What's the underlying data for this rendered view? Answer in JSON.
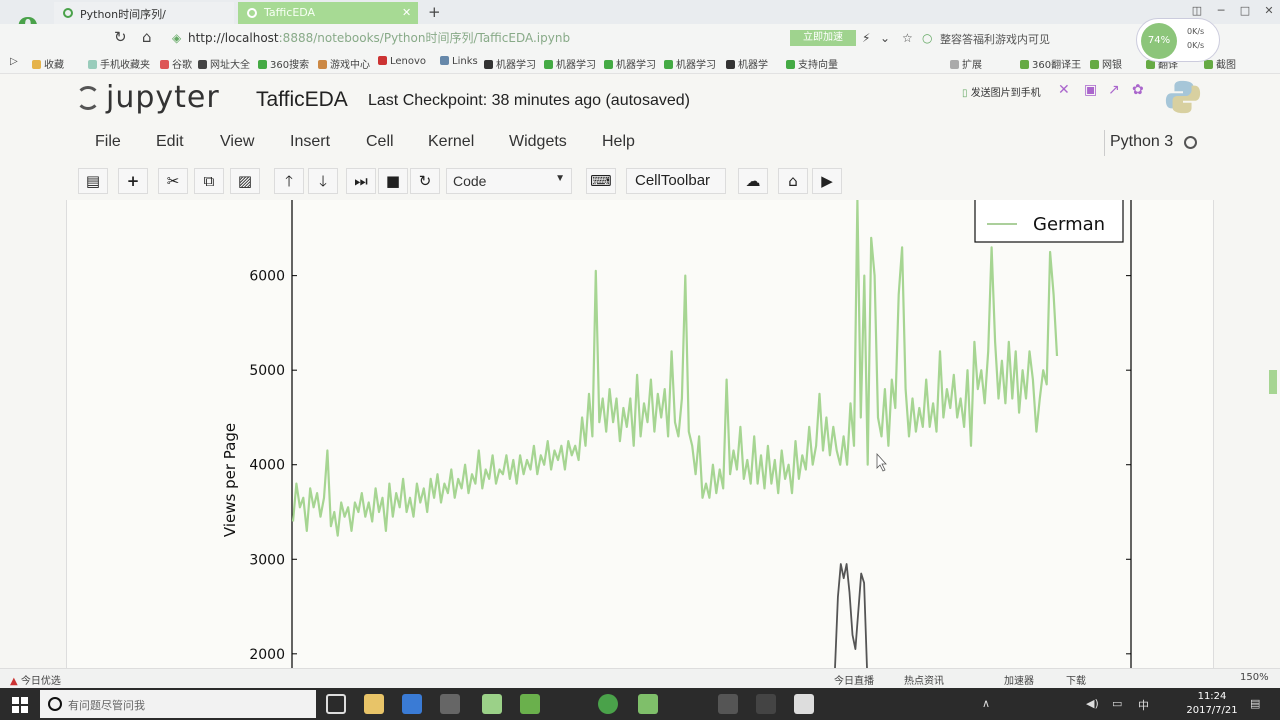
{
  "browser": {
    "logo_glyph": "e",
    "tabs": [
      {
        "label": "Python时间序列/",
        "active": false
      },
      {
        "label": "TafficEDA",
        "active": true
      }
    ],
    "new_tab": "+",
    "address_host": "http://localhost",
    "address_rest": ":8888/notebooks/Python时间序列/TafficEDA.ipynb",
    "speed_button": "立即加速",
    "ad_text": "整容答福利游戏内可见",
    "speed_widget": {
      "percent": "74%",
      "up": "0K/s",
      "down": "0K/s"
    },
    "bookmarks": [
      "收藏",
      "手机收藏夹",
      "谷歌",
      "网址大全",
      "360搜索",
      "游戏中心",
      "Lenovo",
      "Links",
      "机器学习",
      "机器学习",
      "机器学习",
      "机器学习",
      "机器学",
      "支持向量"
    ],
    "bookmarks_right": [
      "扩展",
      "360翻译王",
      "网银",
      "翻译",
      "截图"
    ]
  },
  "jupyter": {
    "logo_text": "jupyter",
    "notebook_name": "TafficEDA",
    "checkpoint": "Last Checkpoint: 38 minutes ago (autosaved)",
    "send_to_phone": "发送图片到手机",
    "menu": [
      "File",
      "Edit",
      "View",
      "Insert",
      "Cell",
      "Kernel",
      "Widgets",
      "Help"
    ],
    "kernel": "Python 3",
    "toolbar_icons": [
      "save-icon",
      "plus-icon",
      "cut-icon",
      "copy-icon",
      "paste-icon",
      "arrow-up-icon",
      "arrow-down-icon",
      "run-icon",
      "stop-icon",
      "restart-icon"
    ],
    "cell_type": "Code",
    "celltoolbar": "CellToolbar"
  },
  "chart_data": {
    "type": "line",
    "title": "",
    "xlabel": "",
    "ylabel": "Views per Page",
    "yticks": [
      6000,
      5000,
      4000,
      3000,
      2000
    ],
    "ylim": [
      1850,
      6800
    ],
    "legend": {
      "position": "top-right",
      "entries": [
        "German"
      ]
    },
    "series": [
      {
        "name": "German",
        "color": "#a6d592",
        "values": [
          3400,
          3800,
          3550,
          3650,
          3300,
          3750,
          3550,
          3700,
          3450,
          3650,
          4150,
          3350,
          3500,
          3250,
          3600,
          3450,
          3550,
          3300,
          3600,
          3500,
          3700,
          3450,
          3600,
          3400,
          3750,
          3500,
          3650,
          3300,
          3800,
          3450,
          3700,
          3550,
          3850,
          3500,
          3650,
          3450,
          3800,
          3600,
          3750,
          3500,
          3850,
          3650,
          3900,
          3600,
          3800,
          3700,
          3950,
          3650,
          3850,
          3750,
          4000,
          3700,
          3900,
          3800,
          4150,
          3750,
          3950,
          3850,
          4100,
          3800,
          3950,
          3900,
          4100,
          3850,
          4050,
          3800,
          4100,
          3900,
          4050,
          3950,
          4200,
          3900,
          4100,
          4000,
          4250,
          3950,
          4150,
          4050,
          4200,
          3950,
          4250,
          4100,
          4200,
          4050,
          4500,
          4200,
          4750,
          4300,
          6050,
          4450,
          4700,
          4350,
          4800,
          4450,
          4700,
          4250,
          4600,
          4400,
          4700,
          4200,
          4950,
          4300,
          4650,
          4450,
          4900,
          4350,
          4750,
          4500,
          4800,
          4300,
          5200,
          4450,
          4300,
          4700,
          6000,
          4350,
          4200,
          3900,
          4300,
          3650,
          3800,
          3650,
          4000,
          3700,
          3950,
          3750,
          4900,
          3900,
          4150,
          3950,
          4400,
          3850,
          4050,
          3800,
          4300,
          3800,
          4100,
          3750,
          4200,
          3800,
          4050,
          3700,
          4150,
          3850,
          4000,
          3700,
          4250,
          3850,
          4100,
          3950,
          4400,
          4000,
          4200,
          4750,
          4150,
          4500,
          4100,
          4400,
          4150,
          4000,
          4300,
          4000,
          4650,
          4200,
          6800,
          4500,
          6000,
          4000,
          6400,
          6000,
          4500,
          4300,
          4800,
          4200,
          4900,
          4600,
          5800,
          6300,
          4800,
          4300,
          4700,
          4350,
          4600,
          4400,
          4900,
          4400,
          4650,
          4350,
          5200,
          4500,
          4800,
          4600,
          4950,
          4500,
          4700,
          4400,
          5000,
          4200,
          5300,
          4800,
          5000,
          4650,
          5200,
          6300,
          5300,
          4700,
          5100,
          4650,
          5300,
          4700,
          5200,
          4550,
          5000,
          4700,
          5200,
          4900,
          4350,
          4700,
          5000,
          4850,
          6250,
          5800,
          5150
        ]
      },
      {
        "name": "",
        "color": "#555555",
        "values": [
          1850,
          2600,
          2950,
          2800,
          2950,
          2650,
          2200,
          2050,
          2450,
          2850,
          2750,
          1850
        ]
      }
    ]
  },
  "status_bar": {
    "left": "今日优选",
    "items": [
      "今日直播",
      "热点资讯",
      "加速器",
      "下载",
      "150%"
    ]
  },
  "taskbar": {
    "search_placeholder": "有问题尽管问我",
    "time": "11:24",
    "date": "2017/7/21",
    "ime": "中"
  }
}
